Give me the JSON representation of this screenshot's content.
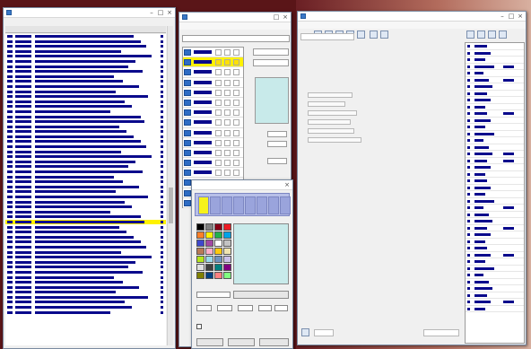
{
  "code_list_window": {
    "title": "",
    "columns": {
      "number": "",
      "code": "",
      "name": ""
    },
    "selected_row_index": 37,
    "row_count": 56
  },
  "color_editor_window": {
    "title": "",
    "menu": [
      "",
      "",
      "",
      ""
    ],
    "filter_value": "",
    "code_combo_value": "",
    "mode_combo_value": "",
    "width_label": "",
    "height_label": "",
    "width_value": "",
    "height_value": "",
    "sample_label": "",
    "selected_row_index": 1,
    "row_count": 16
  },
  "palette_popup": {
    "title": "",
    "name_value": "",
    "button_label": "",
    "rgb_values": [
      "",
      "",
      ""
    ],
    "checkbox_label": "",
    "ok_label": "",
    "apply_label": "",
    "cancel_label": "",
    "highlighted_cell_index": 0,
    "colors": [
      "#000000",
      "#7f7f7f",
      "#880015",
      "#ed1c24",
      "#ff7f27",
      "#fff200",
      "#22b14c",
      "#00a2e8",
      "#3f48cc",
      "#a349a4",
      "#ffffff",
      "#c3c3c3",
      "#b97a57",
      "#ffaec9",
      "#ffc90e",
      "#efe4b0",
      "#b5e61d",
      "#99d9ea",
      "#7092be",
      "#c8bfe7",
      "#e0e0e0",
      "#404040",
      "#008080",
      "#800080",
      "#808000",
      "#004080",
      "#ff8080",
      "#80ff80"
    ],
    "preview_color": "#c8eaea"
  },
  "form_editor_window": {
    "title": "",
    "menu": [
      "",
      "",
      "",
      ""
    ],
    "combo_left_value": "",
    "combo_right_value": "",
    "field_labels": [
      "",
      "",
      "",
      "",
      "",
      ""
    ],
    "status_left": "",
    "status_right": "",
    "property_rows": 40
  },
  "colors": {
    "selection": "#fff200",
    "list_text": "#0a0a8c",
    "accent_blue": "#2e6cc4",
    "swatch": "#c8eaea"
  }
}
